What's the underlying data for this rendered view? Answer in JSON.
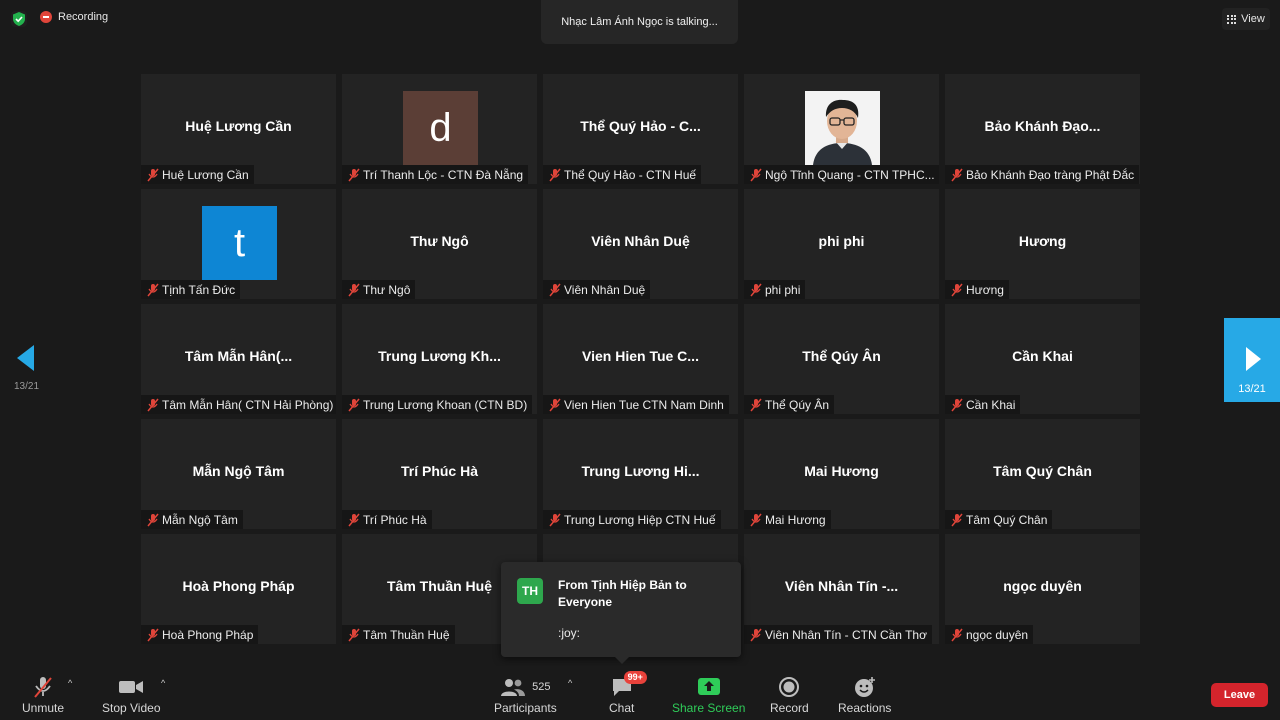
{
  "top": {
    "recording_label": "Recording",
    "talking_text": "Nhạc Lâm Ánh Ngọc is talking...",
    "view_label": "View"
  },
  "pager": {
    "left_label": "13/21",
    "right_label": "13/21"
  },
  "tiles": [
    {
      "big": "Huệ Lương Cần",
      "name": "Huệ Lương Cần"
    },
    {
      "big": "",
      "name": "Trí Thanh Lộc - CTN Đà Nẵng",
      "avatar_letter": "d"
    },
    {
      "big": "Thể Quý Hảo - C...",
      "name": "Thể Quý Hảo - CTN Huế"
    },
    {
      "big": "",
      "name": "Ngộ Tĩnh Quang - CTN TPHC..."
    },
    {
      "big": "Bảo Khánh Đạo...",
      "name": "Bảo Khánh Đạo tràng Phật Đắc"
    },
    {
      "big": "",
      "name": "Tịnh Tấn Đức",
      "avatar_letter": "t"
    },
    {
      "big": "Thư Ngô",
      "name": "Thư Ngô"
    },
    {
      "big": "Viên Nhân Duệ",
      "name": "Viên Nhân Duệ"
    },
    {
      "big": "phi phi",
      "name": "phi phi"
    },
    {
      "big": "Hương",
      "name": "Hương"
    },
    {
      "big": "Tâm Mẫn Hân(...",
      "name": "Tâm Mẫn Hân( CTN Hải Phòng)"
    },
    {
      "big": "Trung Lương Kh...",
      "name": "Trung Lương Khoan (CTN BD)"
    },
    {
      "big": "Vien Hien Tue C...",
      "name": "Vien Hien Tue CTN Nam Dinh"
    },
    {
      "big": "Thể Qúy Ân",
      "name": "Thể Qúy Ân"
    },
    {
      "big": "Cần Khai",
      "name": "Cần Khai"
    },
    {
      "big": "Mẫn Ngộ Tâm",
      "name": "Mẫn Ngộ Tâm"
    },
    {
      "big": "Trí Phúc Hà",
      "name": "Trí Phúc Hà"
    },
    {
      "big": "Trung Lương Hi...",
      "name": "Trung Lương Hiệp CTN Huế"
    },
    {
      "big": "Mai Hương",
      "name": "Mai Hương"
    },
    {
      "big": "Tâm Quý Chân",
      "name": "Tâm Quý Chân"
    },
    {
      "big": "Hoà Phong Pháp",
      "name": "Hoà Phong Pháp"
    },
    {
      "big": "Tâm Thuần Huệ",
      "name": "Tâm Thuần Huệ"
    },
    {
      "big": "",
      "name": ""
    },
    {
      "big": "Viên Nhân Tín -...",
      "name": "Viên Nhân Tín - CTN Cần Thơ"
    },
    {
      "big": "ngọc duyên",
      "name": "ngọc duyên"
    }
  ],
  "chat_popup": {
    "avatar_initials": "TH",
    "from": "From Tịnh Hiệp Bản to Everyone",
    "message": ":joy:"
  },
  "toolbar": {
    "unmute": "Unmute",
    "stop_video": "Stop Video",
    "participants": "Participants",
    "participants_count": "525",
    "chat": "Chat",
    "chat_badge": "99+",
    "share_screen": "Share Screen",
    "record": "Record",
    "reactions": "Reactions",
    "leave": "Leave"
  },
  "colors": {
    "background": "#1a1a1a",
    "tile": "#232323",
    "accent_blue": "#27a9e6",
    "share_green": "#2fcc59",
    "leave_red": "#d4242c",
    "mute_red": "#e0453a"
  }
}
